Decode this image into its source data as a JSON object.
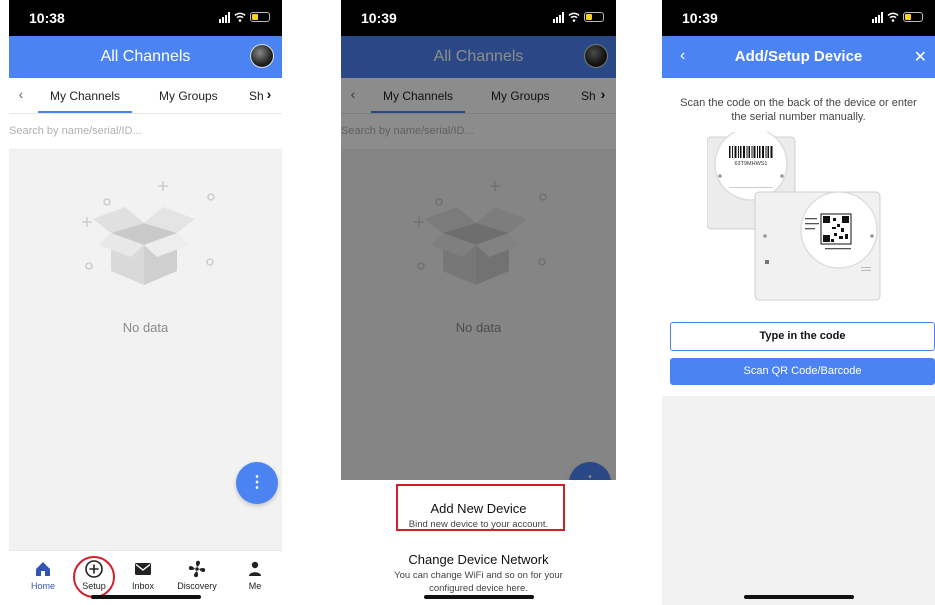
{
  "status": {
    "time_1": "10:38",
    "time_2": "10:39",
    "time_3": "10:39"
  },
  "channels": {
    "title": "All Channels",
    "tabs": [
      "My Channels",
      "My Groups",
      "Sha"
    ],
    "search_placeholder": "Search by name/serial/ID...",
    "empty_text": "No data",
    "fab_label": "⋮"
  },
  "bottom_nav": [
    {
      "label": "Home",
      "icon": "home-icon"
    },
    {
      "label": "Setup",
      "icon": "plus-circle-icon"
    },
    {
      "label": "Inbox",
      "icon": "mail-icon"
    },
    {
      "label": "Discovery",
      "icon": "fan-icon"
    },
    {
      "label": "Me",
      "icon": "person-icon"
    }
  ],
  "sheet": {
    "add_title": "Add New Device",
    "add_sub": "Bind new device to your account.",
    "change_title": "Change Device Network",
    "change_sub_1": "You can change WiFi and so on for your",
    "change_sub_2": "configured device here."
  },
  "setup": {
    "title": "Add/Setup Device",
    "back_label": "‹",
    "close_label": "✕",
    "instr_1": "Scan the code on the back of the device or enter",
    "instr_2": "the serial number manually.",
    "serial_label": "63T9MHWS1",
    "type_button": "Type in the code",
    "scan_button": "Scan QR Code/Barcode"
  },
  "colors": {
    "primary": "#4b83f3",
    "highlight": "#d21f2a",
    "nav_active": "#3454b4"
  }
}
